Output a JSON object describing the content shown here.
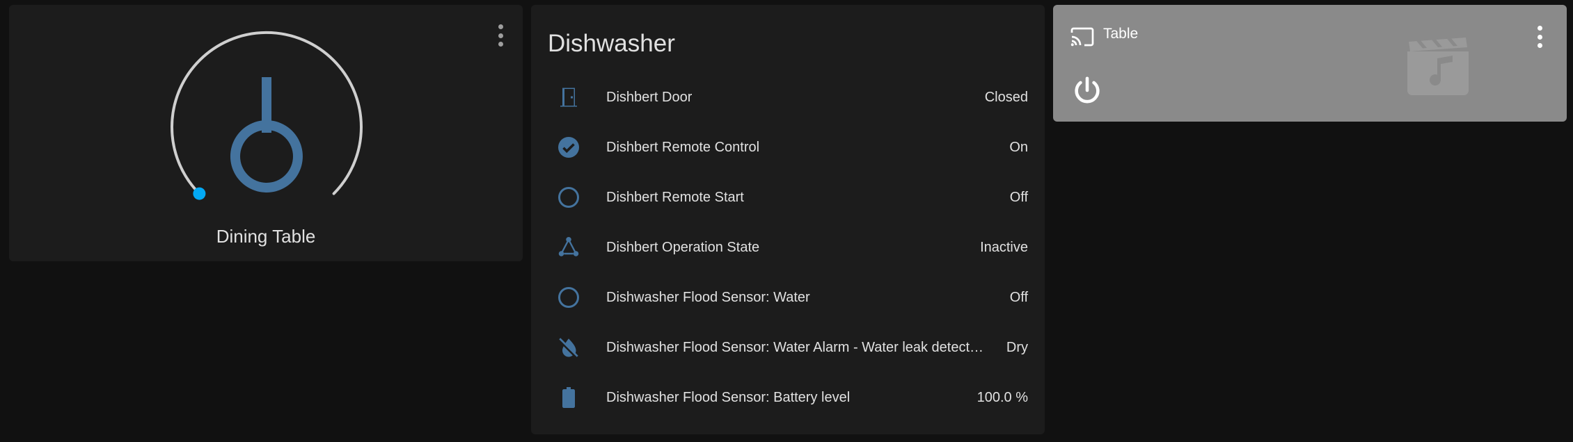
{
  "light_card": {
    "name": "Dining Table",
    "icon": "ceiling-light-icon",
    "brightness_percent": 0,
    "colors": {
      "accent": "#03a9f4",
      "icon": "#44739e",
      "track": "#cfcfcf"
    }
  },
  "entities_card": {
    "title": "Dishwasher",
    "rows": [
      {
        "name": "Dishbert Door",
        "state": "Closed",
        "icon": "door-icon"
      },
      {
        "name": "Dishbert Remote Control",
        "state": "On",
        "icon": "check-circle-icon"
      },
      {
        "name": "Dishbert Remote Start",
        "state": "Off",
        "icon": "circle-outline-icon"
      },
      {
        "name": "Dishbert Operation State",
        "state": "Inactive",
        "icon": "state-machine-icon"
      },
      {
        "name": "Dishwasher Flood Sensor: Water",
        "state": "Off",
        "icon": "circle-outline-icon"
      },
      {
        "name": "Dishwasher Flood Sensor: Water Alarm - Water leak detect…",
        "state": "Dry",
        "icon": "water-off-icon"
      },
      {
        "name": "Dishwasher Flood Sensor: Battery level",
        "state": "100.0 %",
        "icon": "battery-icon"
      }
    ]
  },
  "media_card": {
    "name": "Table",
    "icon": "cast-icon",
    "power_icon": "power-icon",
    "art_icon": "music-video-icon",
    "background": "#8a8a8a"
  }
}
